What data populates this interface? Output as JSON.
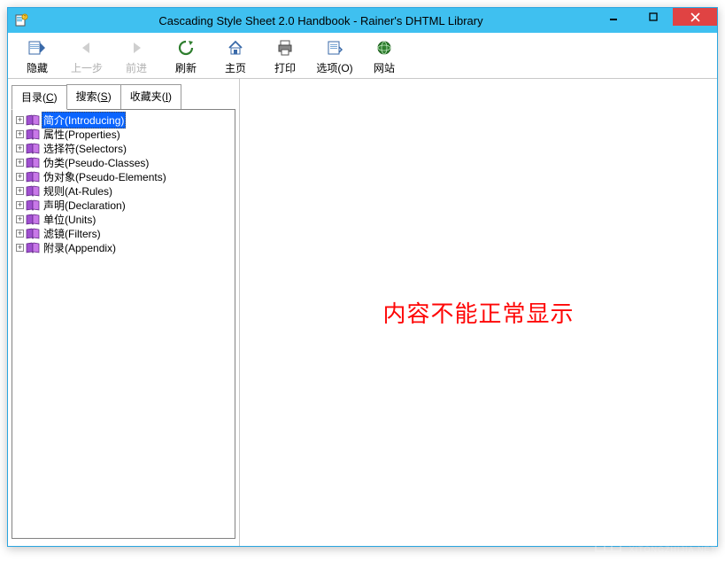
{
  "window": {
    "title": "Cascading Style Sheet 2.0 Handbook - Rainer's DHTML Library"
  },
  "toolbar": {
    "hide": "隐藏",
    "back": "上一步",
    "forward": "前进",
    "refresh": "刷新",
    "home": "主页",
    "print": "打印",
    "options": "选项(O)",
    "website": "网站"
  },
  "tabs": {
    "contents_prefix": "目录(",
    "contents_u": "C",
    "contents_suffix": ")",
    "search_prefix": "搜索(",
    "search_u": "S",
    "search_suffix": ")",
    "fav_prefix": "收藏夹(",
    "fav_u": "I",
    "fav_suffix": ")"
  },
  "tree": [
    {
      "label": "简介(Introducing)",
      "selected": true
    },
    {
      "label": "属性(Properties)"
    },
    {
      "label": "选择符(Selectors)"
    },
    {
      "label": "伪类(Pseudo-Classes)"
    },
    {
      "label": "伪对象(Pseudo-Elements)"
    },
    {
      "label": "规则(At-Rules)"
    },
    {
      "label": "声明(Declaration)"
    },
    {
      "label": "单位(Units)"
    },
    {
      "label": "滤镜(Filters)"
    },
    {
      "label": "附录(Appendix)"
    }
  ],
  "content": {
    "error": "内容不能正常显示"
  },
  "watermark": {
    "line1": "系统之家",
    "line2": "XITONGZHIJIA.NET"
  }
}
